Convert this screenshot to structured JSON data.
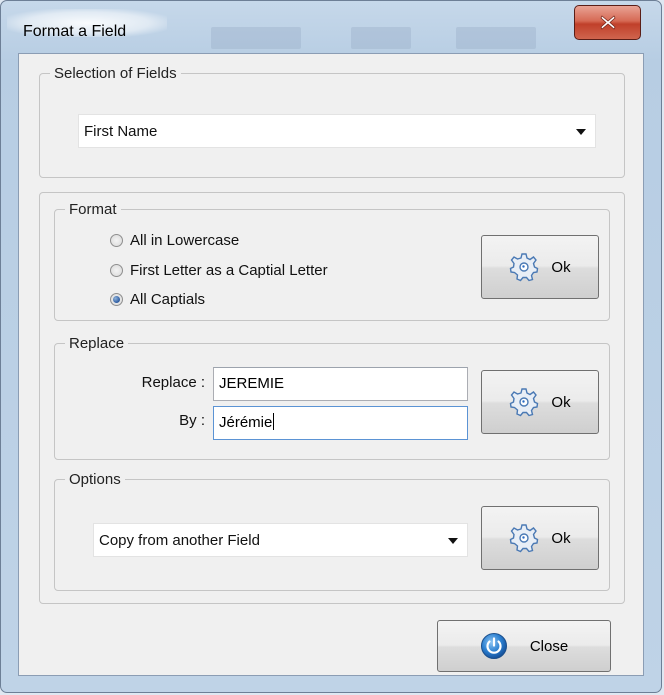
{
  "window": {
    "title": "Format a Field",
    "close_glyph": "X"
  },
  "selection": {
    "legend": "Selection of Fields",
    "selected": "First Name"
  },
  "format": {
    "legend": "Format",
    "options": [
      {
        "label": "All in Lowercase",
        "checked": false
      },
      {
        "label": "First Letter as a Captial Letter",
        "checked": false
      },
      {
        "label": "All Captials",
        "checked": true
      }
    ],
    "ok_label": "Ok"
  },
  "replace": {
    "legend": "Replace",
    "replace_label": "Replace :",
    "replace_value": "JEREMIE",
    "by_label": "By :",
    "by_value": "Jérémie",
    "ok_label": "Ok"
  },
  "options": {
    "legend": "Options",
    "selected": "Copy from another Field",
    "ok_label": "Ok"
  },
  "footer": {
    "close_label": "Close"
  },
  "colors": {
    "accent": "#2b6cc4",
    "close_red": "#c0402a",
    "window_frame": "#bfd3e7"
  },
  "icons": {
    "ok": "gear-icon",
    "close": "power-icon"
  }
}
